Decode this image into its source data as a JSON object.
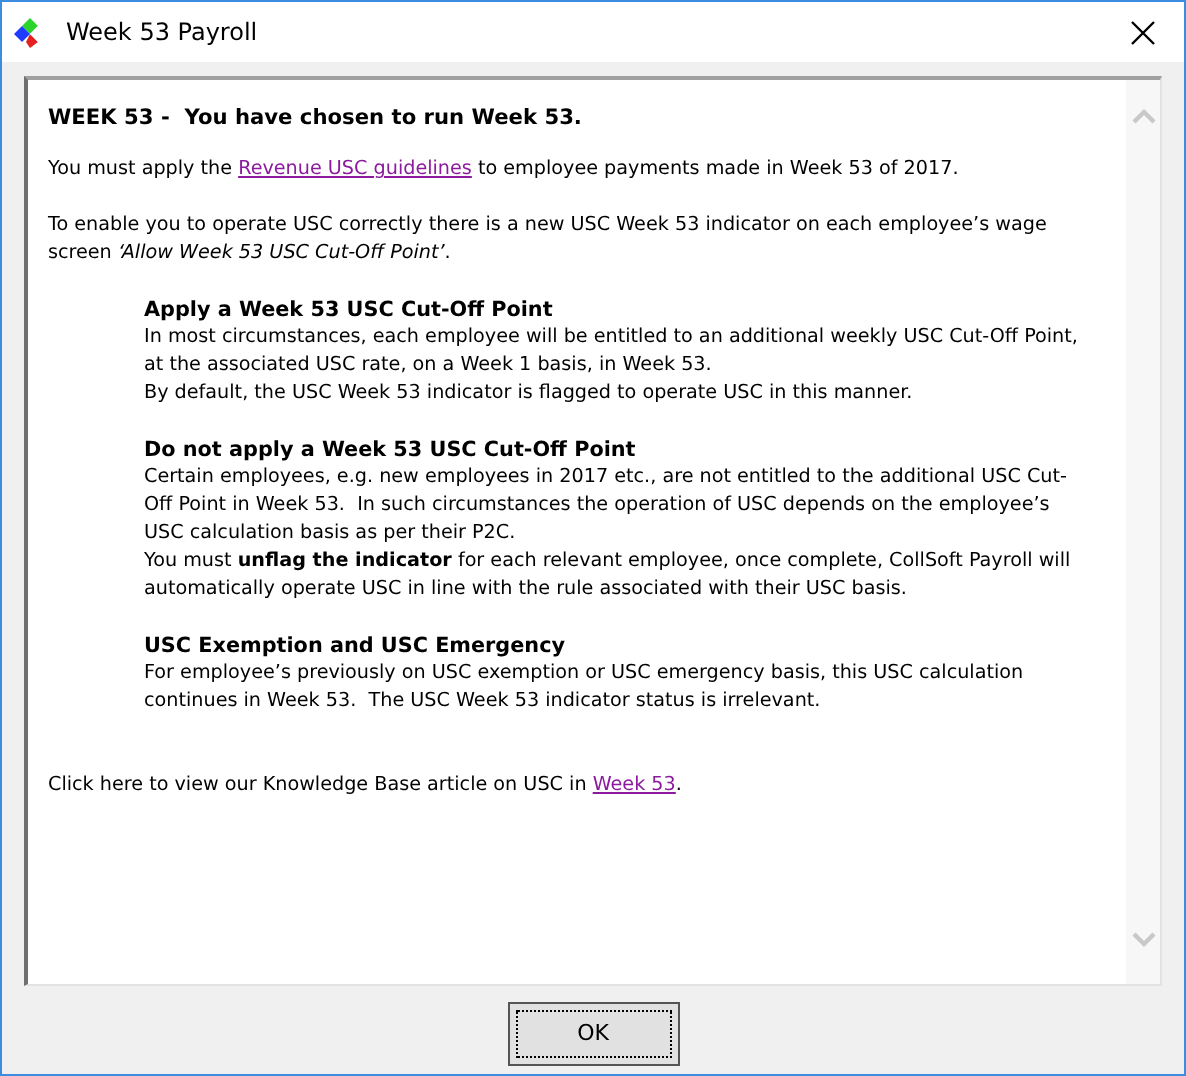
{
  "window": {
    "title": "Week 53 Payroll"
  },
  "heading": "WEEK 53 -  You have chosen to run Week 53.",
  "intro": [
    {
      "before": "You must apply the ",
      "link": "Revenue USC guidelines",
      "after": " to employee payments made in Week 53 of 2017."
    },
    {
      "lines": [
        "To enable you to operate USC correctly there is a new USC Week 53 indicator on each employee’s wage",
        "screen *‘Allow Week 53 USC Cut-Off Point’*."
      ]
    }
  ],
  "sections": [
    {
      "title": "Apply a Week 53 USC Cut-Off Point",
      "lines": [
        "In most circumstances, each employee will be entitled to an additional weekly USC Cut-Off Point,",
        "at the associated USC rate, on a Week 1 basis, in Week 53.",
        "By default, the USC Week 53 indicator is flagged to operate USC in this manner."
      ]
    },
    {
      "title": "Do not apply a Week 53 USC Cut-Off Point",
      "lines": [
        "Certain employees, e.g. new employees in 2017 etc., are not entitled to the additional USC Cut-",
        "Off Point in Week 53.  In such circumstances the operation of USC depends on the employee’s",
        "USC calculation basis as per their P2C.",
        "You must **unflag the indicator** for each relevant employee, once complete, CollSoft Payroll will",
        "automatically operate USC in line with the rule associated with their USC basis."
      ]
    },
    {
      "title": "USC Exemption and USC Emergency",
      "lines": [
        "For employee’s previously on USC exemption or USC emergency basis, this USC calculation",
        "continues in Week 53.  The USC Week 53 indicator status is irrelevant."
      ]
    }
  ],
  "footer": {
    "before": "Click here to view our Knowledge Base article on USC in ",
    "link": "Week 53",
    "after": "."
  },
  "buttons": [
    "OK"
  ]
}
